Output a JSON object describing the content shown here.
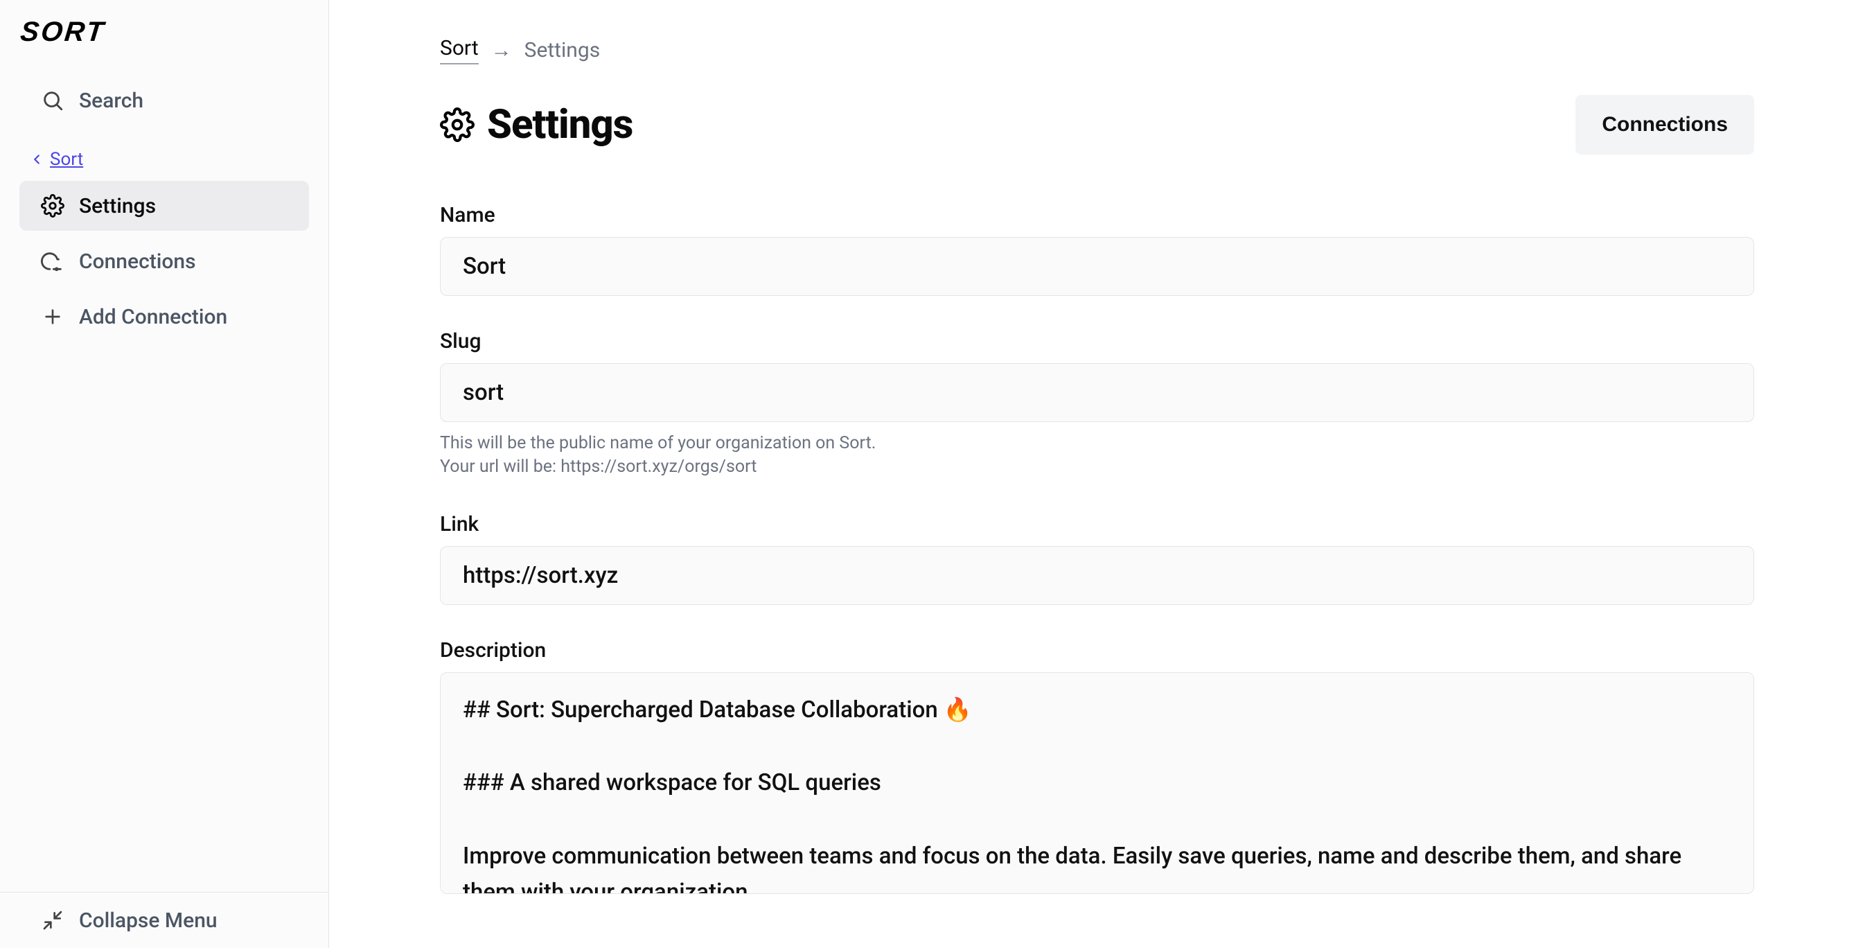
{
  "app": {
    "logo": "SORT"
  },
  "sidebar": {
    "search_label": "Search",
    "back_label": "Sort",
    "settings_label": "Settings",
    "connections_label": "Connections",
    "add_connection_label": "Add Connection",
    "collapse_label": "Collapse Menu"
  },
  "breadcrumb": {
    "root": "Sort",
    "current": "Settings"
  },
  "header": {
    "title": "Settings",
    "connections_button": "Connections"
  },
  "form": {
    "name": {
      "label": "Name",
      "value": "Sort"
    },
    "slug": {
      "label": "Slug",
      "value": "sort",
      "hint_line1": "This will be the public name of your organization on Sort.",
      "hint_line2": "Your url will be: https://sort.xyz/orgs/sort"
    },
    "link": {
      "label": "Link",
      "value": "https://sort.xyz"
    },
    "description": {
      "label": "Description",
      "value": "## Sort: Supercharged Database Collaboration 🔥\n\n### A shared workspace for SQL queries\n\nImprove communication between teams and focus on the data. Easily save queries, name and describe them, and share them with your organization."
    }
  }
}
